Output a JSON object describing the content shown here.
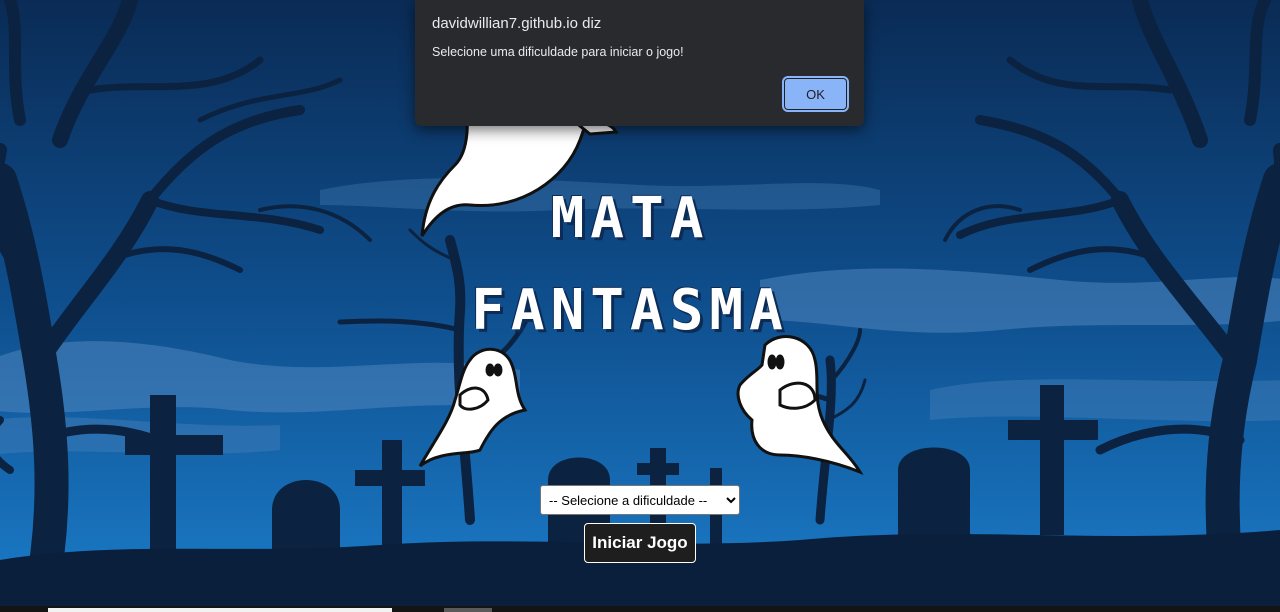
{
  "game": {
    "title_line1": "MATA",
    "title_line2": "FANTASMA"
  },
  "difficulty": {
    "selected": "-- Selecione a dificuldade --",
    "options": [
      "-- Selecione a dificuldade --"
    ]
  },
  "start_button": {
    "label": "Iniciar Jogo"
  },
  "alert": {
    "origin": "davidwillian7.github.io diz",
    "message": "Selecione uma dificuldade para iniciar o jogo!",
    "ok_label": "OK"
  },
  "colors": {
    "sky_top": "#0b2f5c",
    "sky_bottom": "#1a78c4",
    "silhouette": "#0b2240",
    "ghost": "#ffffff",
    "dialog_bg": "#292a2d",
    "dialog_button": "#8ab4f8"
  }
}
